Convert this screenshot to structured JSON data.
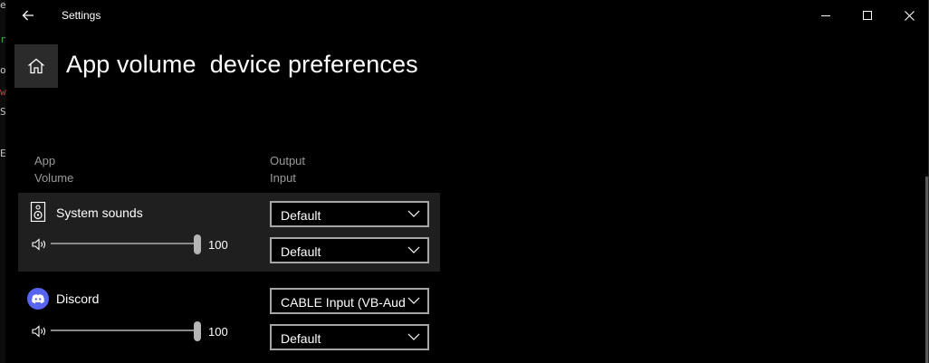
{
  "window": {
    "title": "Settings",
    "left_edge_chars": [
      "e",
      "r",
      "o",
      "w",
      "S",
      "E"
    ],
    "left_edge_colors": [
      "#c8c8c8",
      "#3fae3f",
      "#c8c8c8",
      "#d23c3c",
      "#c8c8c8",
      "#c8c8c8"
    ]
  },
  "page": {
    "title": "App volume  device preferences"
  },
  "columns": {
    "left_line1": "App",
    "left_line2": "Volume",
    "right_line1": "Output",
    "right_line2": "Input"
  },
  "apps": [
    {
      "name": "System sounds",
      "icon": "speaker-icon",
      "volume": 100,
      "output": "Default",
      "input": "Default"
    },
    {
      "name": "Discord",
      "icon": "discord-icon",
      "icon_color": "#5865f2",
      "volume": 100,
      "output": "CABLE Input (VB-Audio",
      "input": "Default"
    }
  ]
}
